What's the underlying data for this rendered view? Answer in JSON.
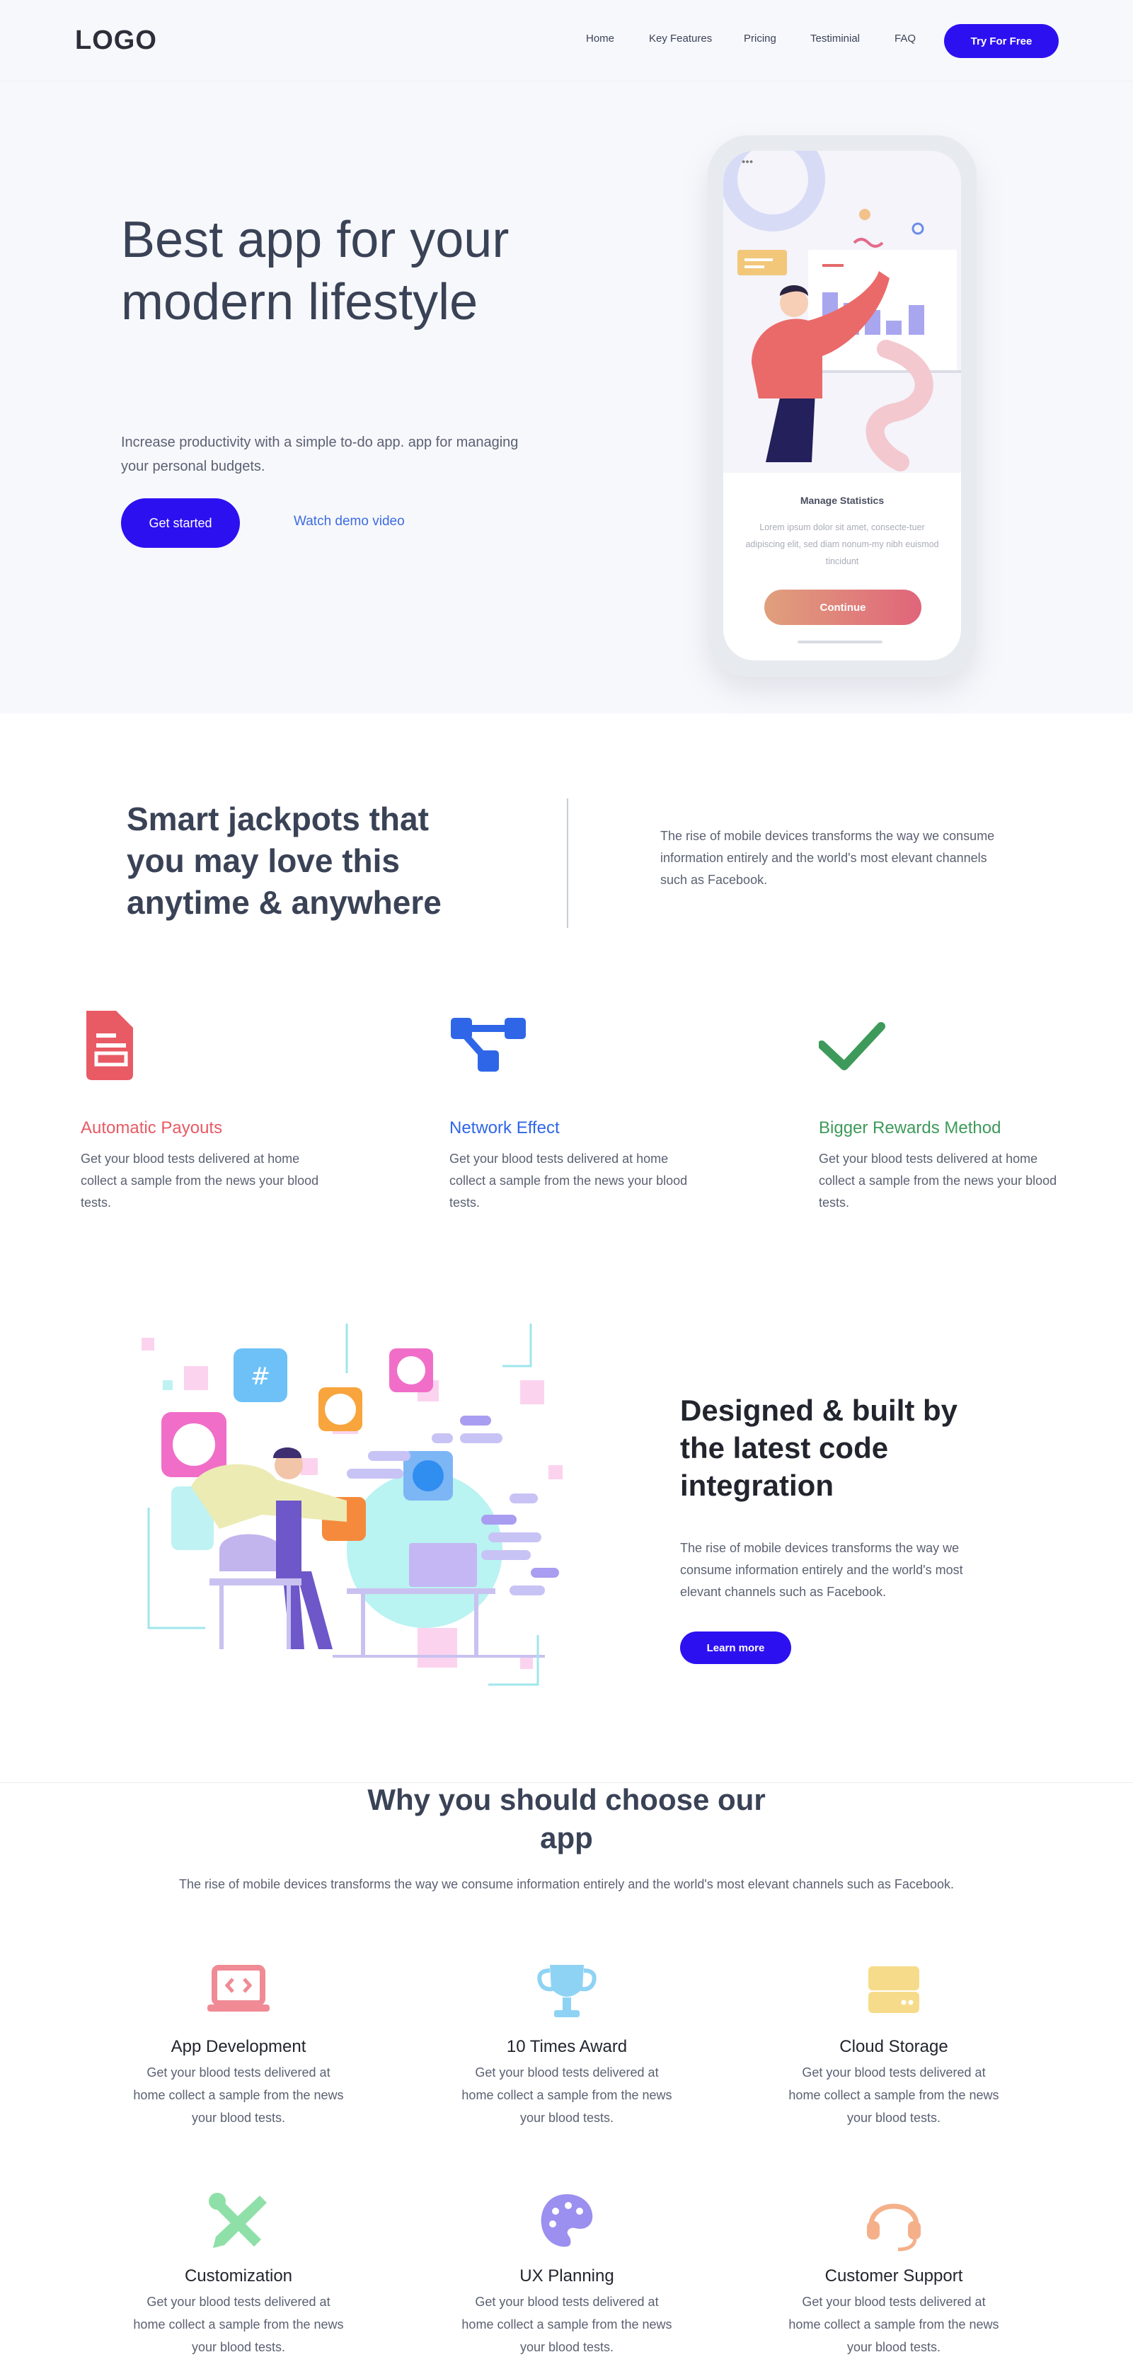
{
  "nav": {
    "logo": "LOGO",
    "links": [
      "Home",
      "Key Features",
      "Pricing",
      "Testiminial",
      "FAQ"
    ],
    "cta": "Try For Free"
  },
  "hero": {
    "title": "Best app for your modern lifestyle",
    "subtitle": "Increase productivity with a simple to-do app. app for managing your personal budgets.",
    "primary_button": "Get started",
    "secondary_link": "Watch demo video",
    "phone": {
      "card_title": "Manage Statistics",
      "card_text": "Lorem ipsum dolor sit amet, consecte-tuer adipiscing elit, sed diam nonum-my nibh euismod tincidunt",
      "button": "Continue"
    }
  },
  "jackpots": {
    "title": "Smart jackpots that you may love this anytime & anywhere",
    "text": "The rise of mobile devices transforms the way we consume information entirely and the world's most elevant channels such as Facebook."
  },
  "features": [
    {
      "title": "Automatic Payouts",
      "text": "Get your blood tests delivered at home collect a sample from the news your blood tests.",
      "color": "#e85a64",
      "icon": "document-icon"
    },
    {
      "title": "Network Effect",
      "text": "Get your blood tests delivered at home collect a sample from the news your blood tests.",
      "color": "#2f66e8",
      "icon": "network-icon"
    },
    {
      "title": "Bigger Rewards Method",
      "text": "Get your blood tests delivered at home collect a sample from the news your blood tests.",
      "color": "#3d9a5a",
      "icon": "checkmark-icon"
    }
  ],
  "integration": {
    "title": "Designed & built by the latest code integration",
    "text": "The rise of mobile devices transforms the way we consume information entirely and the world's most elevant channels such as Facebook.",
    "button": "Learn more"
  },
  "why": {
    "title": "Why you should choose our app",
    "subtitle": "The rise of mobile devices transforms the way we consume information entirely and the world's most elevant channels such as Facebook.",
    "cards": [
      {
        "title": "App Development",
        "text": "Get your blood tests delivered at home collect a sample from the news your blood tests.",
        "icon": "code-laptop-icon"
      },
      {
        "title": "10 Times Award",
        "text": "Get your blood tests delivered at home collect a sample from the news your blood tests.",
        "icon": "trophy-icon"
      },
      {
        "title": "Cloud Storage",
        "text": "Get your blood tests delivered at home collect a sample from the news your blood tests.",
        "icon": "server-icon"
      },
      {
        "title": "Customization",
        "text": "Get your blood tests delivered at home collect a sample from the news your blood tests.",
        "icon": "tools-icon"
      },
      {
        "title": "UX Planning",
        "text": "Get your blood tests delivered at home collect a sample from the news your blood tests.",
        "icon": "palette-icon"
      },
      {
        "title": "Customer Support",
        "text": "Get your blood tests delivered at home collect a sample from the news your blood tests.",
        "icon": "headset-icon"
      }
    ]
  },
  "colors": {
    "primary": "#2d10f0",
    "heading": "#3a4256",
    "body": "#5b6172",
    "hero_bg": "#f7f8fc"
  }
}
